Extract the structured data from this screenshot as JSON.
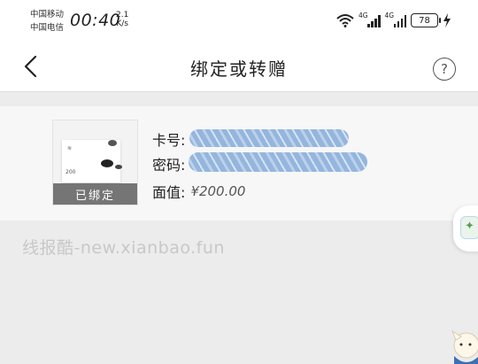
{
  "status_bar": {
    "carrier_1": "中国移动",
    "carrier_2": "中国电信",
    "time": "00:40",
    "net_speed_value": "2.1",
    "net_speed_unit": "K/s",
    "signal_1_label": "4G",
    "signal_2_label": "4G",
    "battery": "78"
  },
  "nav": {
    "title": "绑定或转赠",
    "help_label": "?"
  },
  "card": {
    "status_badge": "已绑定",
    "thumb_amount": "200",
    "card_no_label": "卡号:",
    "password_label": "密码:",
    "face_value_label": "面值:",
    "face_value": "¥200.00"
  },
  "watermark": "线报酷-new.xianbao.fun"
}
